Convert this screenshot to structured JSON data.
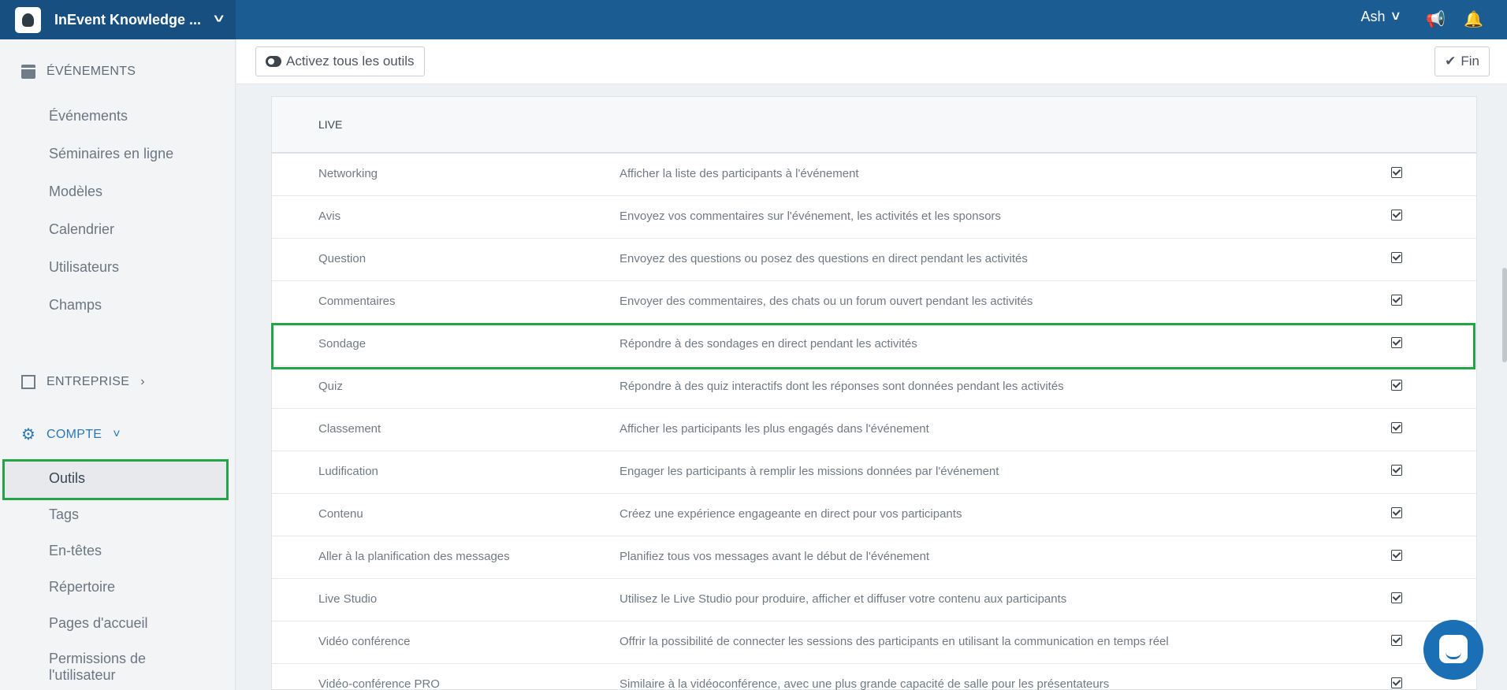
{
  "app": {
    "title": "InEvent Knowledge ...",
    "user": "Ash"
  },
  "sidebar": {
    "events_header": "ÉVÉNEMENTS",
    "events_items": [
      {
        "label": "Événements"
      },
      {
        "label": "Séminaires en ligne"
      },
      {
        "label": "Modèles"
      },
      {
        "label": "Calendrier"
      },
      {
        "label": "Utilisateurs"
      },
      {
        "label": "Champs"
      }
    ],
    "company_header": "ENTREPRISE",
    "account_header": "COMPTE",
    "account_items": [
      {
        "label": "Outils"
      },
      {
        "label": "Tags"
      },
      {
        "label": "En-têtes"
      },
      {
        "label": "Répertoire"
      },
      {
        "label": "Pages d'accueil"
      },
      {
        "label": "Permissions de l'utilisateur"
      }
    ]
  },
  "toolbar": {
    "enable_all": "Activez tous les outils",
    "done": "Fin"
  },
  "table": {
    "section": "LIVE",
    "rows": [
      {
        "name": "Networking",
        "desc": "Afficher la liste des participants à l'événement",
        "checked": true
      },
      {
        "name": "Avis",
        "desc": "Envoyez vos commentaires sur l'événement, les activités et les sponsors",
        "checked": true
      },
      {
        "name": "Question",
        "desc": "Envoyez des questions ou posez des questions en direct pendant les activités",
        "checked": true
      },
      {
        "name": "Commentaires",
        "desc": "Envoyer des commentaires, des chats ou un forum ouvert pendant les activités",
        "checked": true
      },
      {
        "name": "Sondage",
        "desc": "Répondre à des sondages en direct pendant les activités",
        "checked": true
      },
      {
        "name": "Quiz",
        "desc": "Répondre à des quiz interactifs dont les réponses sont données pendant les activités",
        "checked": true
      },
      {
        "name": "Classement",
        "desc": "Afficher les participants les plus engagés dans l'événement",
        "checked": true
      },
      {
        "name": "Ludification",
        "desc": "Engager les participants à remplir les missions données par l'événement",
        "checked": true
      },
      {
        "name": "Contenu",
        "desc": "Créez une expérience engageante en direct pour vos participants",
        "checked": true
      },
      {
        "name": "Aller à la planification des messages",
        "desc": "Planifiez tous vos messages avant le début de l'événement",
        "checked": true
      },
      {
        "name": "Live Studio",
        "desc": "Utilisez le Live Studio pour produire, afficher et diffuser votre contenu aux participants",
        "checked": true
      },
      {
        "name": "Vidéo conférence",
        "desc": "Offrir la possibilité de connecter les sessions des participants en utilisant la communication en temps réel",
        "checked": true
      },
      {
        "name": "Vidéo-conférence PRO",
        "desc": "Similaire à la vidéoconférence, avec une plus grande capacité de salle pour les présentateurs",
        "checked": true
      }
    ]
  }
}
